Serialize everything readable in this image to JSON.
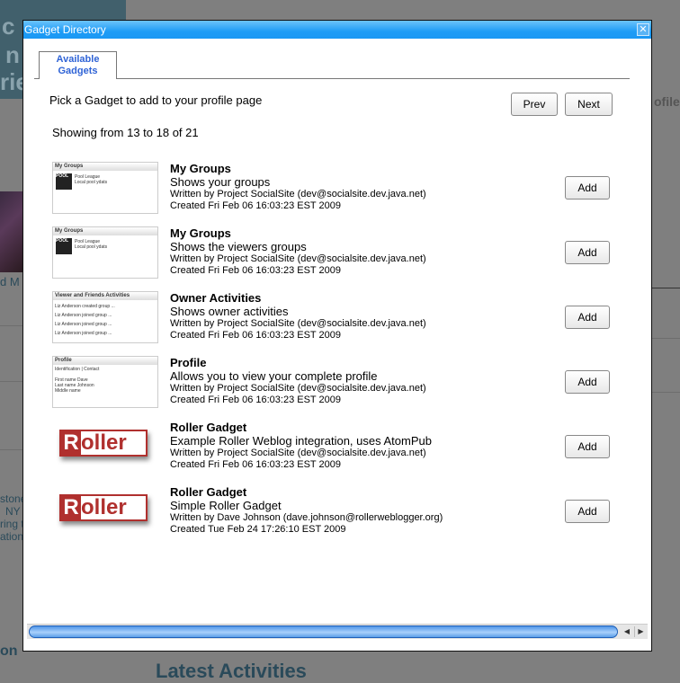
{
  "background": {
    "fragments": {
      "top1": "c",
      "top2": "n",
      "top3": "rie",
      "name": "d M",
      "profile": "ofile",
      "stone": "stone",
      "ny": "NY",
      "ring": "ring t",
      "ation": "ation",
      "on": "on",
      "latest": "Latest Activities"
    }
  },
  "dialog": {
    "title": "Gadget Directory",
    "close_icon": "close-icon",
    "tab": "Available Gadgets",
    "instructions": "Pick a Gadget to add to your profile page",
    "prev": "Prev",
    "next": "Next",
    "showing": "Showing from 13 to 18 of 21",
    "add_label": "Add",
    "gadgets": [
      {
        "name": "My Groups",
        "description": "Shows your groups",
        "author": "Written by Project SocialSite (dev@socialsite.dev.java.net)",
        "created": "Created Fri Feb 06 16:03:23 EST 2009",
        "thumb": "My Groups"
      },
      {
        "name": "My Groups",
        "description": "Shows the viewers groups",
        "author": "Written by Project SocialSite (dev@socialsite.dev.java.net)",
        "created": "Created Fri Feb 06 16:03:23 EST 2009",
        "thumb": "My Groups"
      },
      {
        "name": "Owner Activities",
        "description": "Shows owner activities",
        "author": "Written by Project SocialSite (dev@socialsite.dev.java.net)",
        "created": "Created Fri Feb 06 16:03:23 EST 2009",
        "thumb": "Viewer and Friends Activities"
      },
      {
        "name": "Profile",
        "description": "Allows you to view your complete profile",
        "author": "Written by Project SocialSite (dev@socialsite.dev.java.net)",
        "created": "Created Fri Feb 06 16:03:23 EST 2009",
        "thumb": "Profile"
      },
      {
        "name": "Roller Gadget",
        "description": "Example Roller Weblog integration, uses AtomPub",
        "author": "Written by Project SocialSite (dev@socialsite.dev.java.net)",
        "created": "Created Fri Feb 06 16:03:23 EST 2009",
        "thumb": "Roller"
      },
      {
        "name": "Roller Gadget",
        "description": "Simple Roller Gadget",
        "author": "Written by Dave Johnson (dave.johnson@rollerweblogger.org)",
        "created": "Created Tue Feb 24 17:26:10 EST 2009",
        "thumb": "Roller"
      }
    ]
  }
}
